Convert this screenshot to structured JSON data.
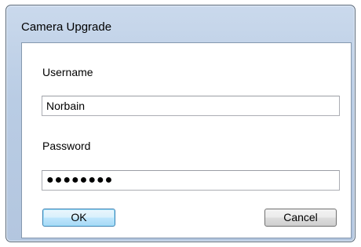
{
  "window": {
    "title": "Camera Upgrade"
  },
  "form": {
    "username_label": "Username",
    "username_value": "Norbain",
    "password_label": "Password",
    "password_mask": "●●●●●●●●"
  },
  "buttons": {
    "ok": "OK",
    "cancel": "Cancel"
  }
}
